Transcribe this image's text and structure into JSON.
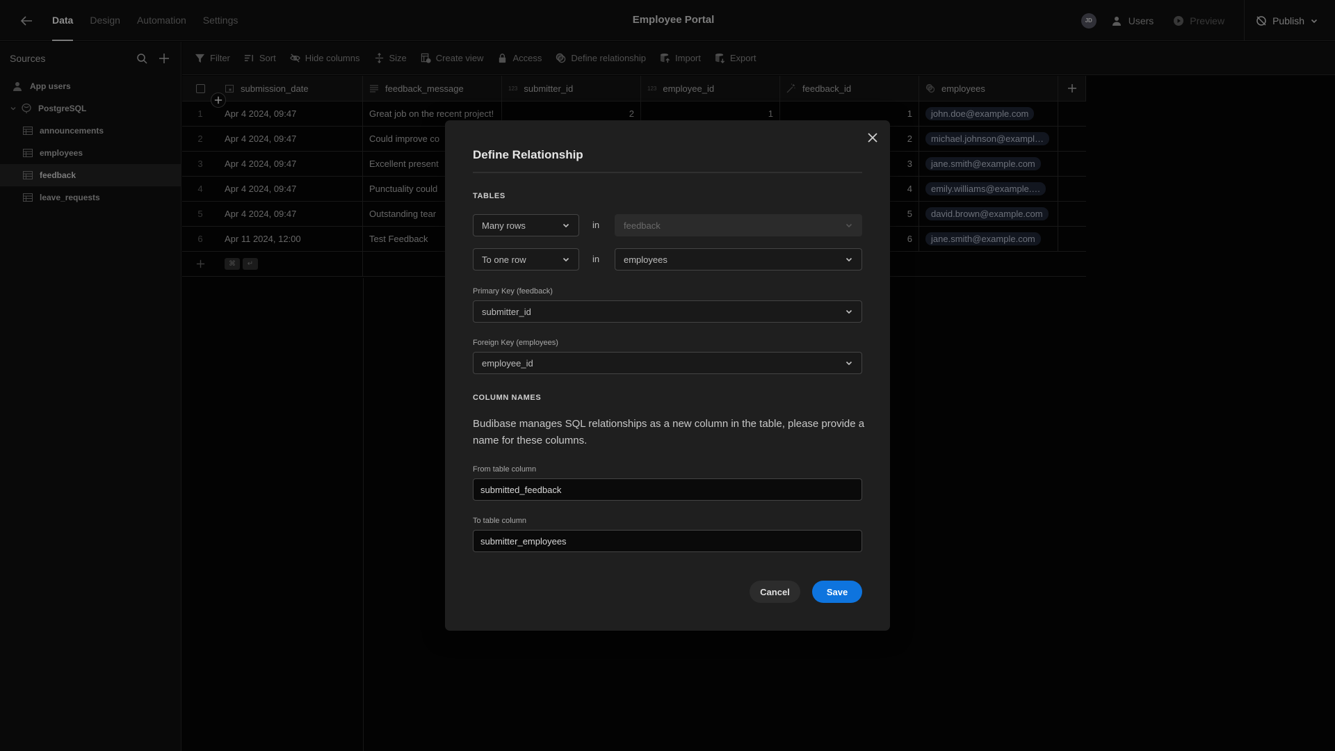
{
  "app": {
    "title": "Employee Portal",
    "tabs": [
      {
        "label": "Data",
        "active": true
      },
      {
        "label": "Design",
        "active": false
      },
      {
        "label": "Automation",
        "active": false
      },
      {
        "label": "Settings",
        "active": false
      }
    ],
    "avatar_initials": "JD",
    "users_label": "Users",
    "preview_label": "Preview",
    "publish_label": "Publish"
  },
  "sidebar": {
    "title": "Sources",
    "items": [
      {
        "label": "App users",
        "icon": "users-icon",
        "level": 0
      },
      {
        "label": "PostgreSQL",
        "icon": "postgresql-icon",
        "level": 1,
        "expanded": true
      },
      {
        "label": "announcements",
        "icon": "table-icon",
        "level": 2
      },
      {
        "label": "employees",
        "icon": "table-icon",
        "level": 2
      },
      {
        "label": "feedback",
        "icon": "table-icon",
        "level": 2,
        "active": true
      },
      {
        "label": "leave_requests",
        "icon": "table-icon",
        "level": 2
      }
    ]
  },
  "toolbar": {
    "items": [
      {
        "label": "Filter",
        "icon": "filter-icon"
      },
      {
        "label": "Sort",
        "icon": "sort-icon"
      },
      {
        "label": "Hide columns",
        "icon": "eye-off-icon"
      },
      {
        "label": "Size",
        "icon": "size-icon"
      },
      {
        "label": "Create view",
        "icon": "create-view-icon"
      },
      {
        "label": "Access",
        "icon": "lock-icon"
      },
      {
        "label": "Define relationship",
        "icon": "relationship-icon"
      },
      {
        "label": "Import",
        "icon": "import-icon"
      },
      {
        "label": "Export",
        "icon": "export-icon"
      }
    ]
  },
  "table": {
    "columns": [
      {
        "name": "submission_date",
        "type_icon": "calendar-icon"
      },
      {
        "name": "feedback_message",
        "type_icon": "text-icon"
      },
      {
        "name": "submitter_id",
        "type_icon": "123"
      },
      {
        "name": "employee_id",
        "type_icon": "123"
      },
      {
        "name": "feedback_id",
        "type_icon": "magic-wand-icon"
      },
      {
        "name": "employees",
        "type_icon": "link-icon"
      }
    ],
    "rows": [
      {
        "index": "1",
        "submission_date": "Apr 4 2024, 09:47",
        "feedback_message": "Great job on the recent project!",
        "submitter_id": "2",
        "employee_id": "1",
        "feedback_id": "1",
        "employees": "john.doe@example.com"
      },
      {
        "index": "2",
        "submission_date": "Apr 4 2024, 09:47",
        "feedback_message": "Could improve co",
        "submitter_id": "",
        "employee_id": "",
        "feedback_id": "2",
        "employees": "michael.johnson@exampl…"
      },
      {
        "index": "3",
        "submission_date": "Apr 4 2024, 09:47",
        "feedback_message": "Excellent present",
        "submitter_id": "",
        "employee_id": "",
        "feedback_id": "3",
        "employees": "jane.smith@example.com"
      },
      {
        "index": "4",
        "submission_date": "Apr 4 2024, 09:47",
        "feedback_message": "Punctuality could",
        "submitter_id": "",
        "employee_id": "",
        "feedback_id": "4",
        "employees": "emily.williams@example.…"
      },
      {
        "index": "5",
        "submission_date": "Apr 4 2024, 09:47",
        "feedback_message": "Outstanding tear",
        "submitter_id": "",
        "employee_id": "",
        "feedback_id": "5",
        "employees": "david.brown@example.com"
      },
      {
        "index": "6",
        "submission_date": "Apr 11 2024, 12:00",
        "feedback_message": "Test Feedback",
        "submitter_id": "",
        "employee_id": "",
        "feedback_id": "6",
        "employees": "jane.smith@example.com"
      }
    ],
    "new_row_shortcut": [
      "⌘",
      "↵"
    ]
  },
  "modal": {
    "title": "Define Relationship",
    "tables_heading": "TABLES",
    "row1": {
      "cardinality": "Many rows",
      "in_label": "in",
      "table": "feedback",
      "table_disabled": true
    },
    "row2": {
      "cardinality": "To one row",
      "in_label": "in",
      "table": "employees"
    },
    "primary_key_label": "Primary Key (feedback)",
    "primary_key_value": "submitter_id",
    "foreign_key_label": "Foreign Key (employees)",
    "foreign_key_value": "employee_id",
    "column_names_heading": "COLUMN NAMES",
    "description": "Budibase manages SQL relationships as a new column in the table, please provide a name for these columns.",
    "from_label": "From table column",
    "from_value": "submitted_feedback",
    "to_label": "To table column",
    "to_value": "submitter_employees",
    "cancel_label": "Cancel",
    "save_label": "Save",
    "accent_color": "#0e74de"
  }
}
